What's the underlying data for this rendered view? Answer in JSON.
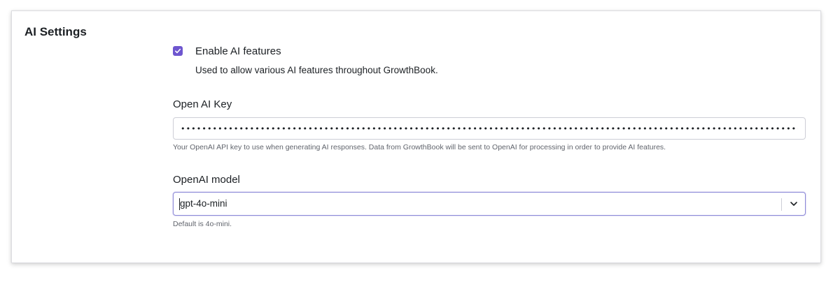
{
  "section": {
    "title": "AI Settings"
  },
  "ai_features": {
    "label": "Enable AI features",
    "checked": true,
    "description": "Used to allow various AI features throughout GrowthBook."
  },
  "openai_key": {
    "label": "Open AI Key",
    "value": "••••••••••••••••••••••••••••••••••••••••••••••••••••••••••••••••••••••••••••••••••••••••••••••••••••••••••••••••••••••••••••••••",
    "help": "Your OpenAI API key to use when generating AI responses. Data from GrowthBook will be sent to OpenAI for processing in order to provide AI features."
  },
  "openai_model": {
    "label": "OpenAI model",
    "selected": "gpt-4o-mini",
    "help": "Default is 4o-mini."
  },
  "colors": {
    "accent": "#6e56cf",
    "text": "#1c2024",
    "muted": "#60646c",
    "border": "#cdced6",
    "focus_border": "#8e8cd8"
  },
  "icons": {
    "checkbox": "check-icon",
    "select": "chevron-down-icon"
  }
}
